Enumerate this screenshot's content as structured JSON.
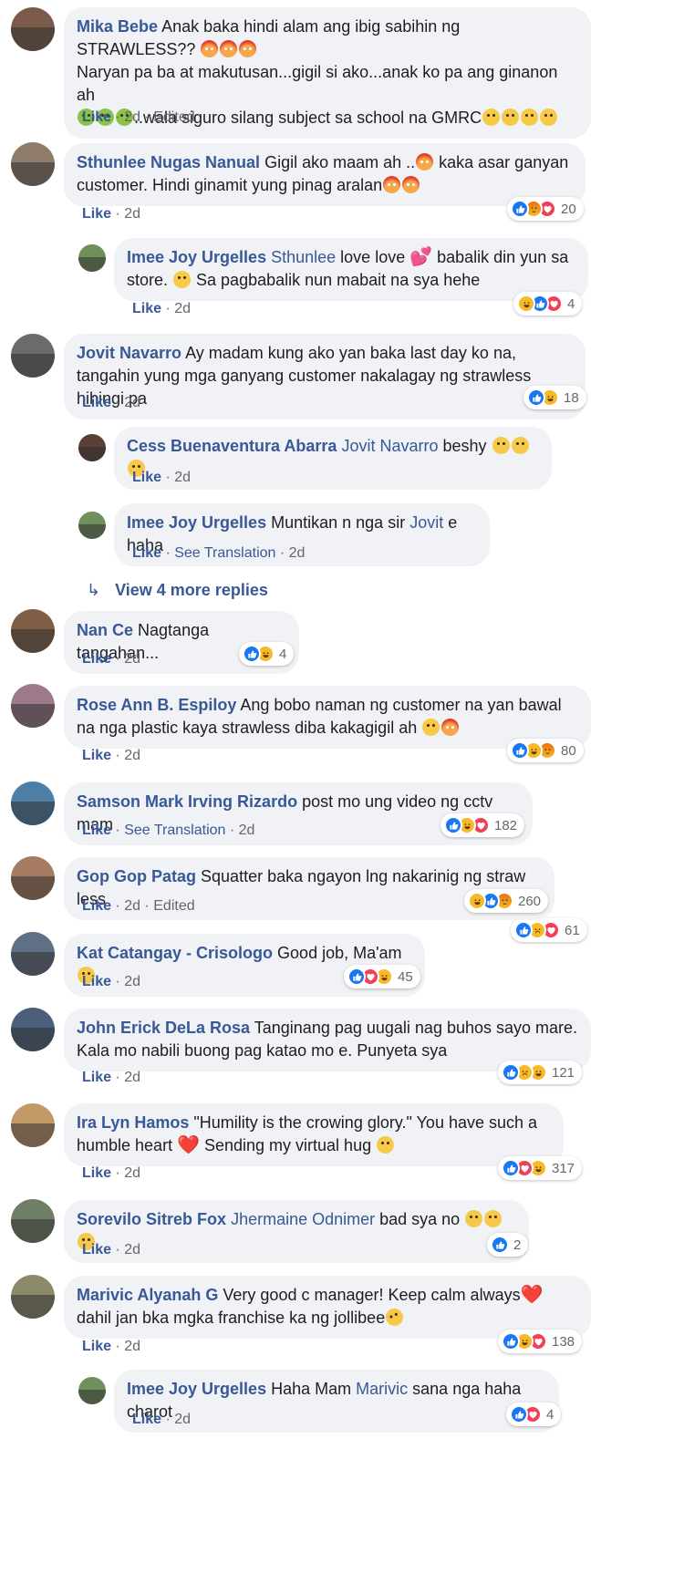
{
  "comments": [
    {
      "author": "Mika Bebe",
      "parts": [
        {
          "t": "Anak baka hindi alam ang ibig sabihin ng STRAWLESS?? "
        },
        {
          "e": "angry"
        },
        {
          "e": "angry"
        },
        {
          "e": "angry"
        },
        {
          "br": true
        },
        {
          "t": "Naryan pa ba at makutusan...gigil si ako...anak ko pa ang ginanon ah "
        },
        {
          "br": true
        },
        {
          "e": "sick"
        },
        {
          "e": "sick"
        },
        {
          "e": "sick"
        },
        {
          "t": "..wala siguro silang subject sa school na GMRC"
        },
        {
          "e": "neutral"
        },
        {
          "e": "neutral"
        },
        {
          "e": "neutral"
        },
        {
          "e": "neutral"
        }
      ],
      "like_label": "Like",
      "time": "2d",
      "edited": "Edited",
      "reactions": [
        "like",
        "sad",
        "love"
      ],
      "reaction_count": "61"
    },
    {
      "author": "Sthunlee Nugas Nanual",
      "parts": [
        {
          "t": "Gigil ako maam ah .."
        },
        {
          "e": "angry"
        },
        {
          "t": " kaka asar ganyan customer. Hindi ginamit yung pinag aralan"
        },
        {
          "e": "angry"
        },
        {
          "e": "angry"
        }
      ],
      "like_label": "Like",
      "time": "2d",
      "reactions": [
        "like",
        "angry",
        "love"
      ],
      "reaction_count": "20"
    },
    {
      "author": "Imee Joy Urgelles",
      "reply": true,
      "parts": [
        {
          "tag": "Sthunlee"
        },
        {
          "t": " love love "
        },
        {
          "heart": "💕"
        },
        {
          "t": " babalik din yun sa store. "
        },
        {
          "e": "smile"
        },
        {
          "t": " Sa pagbabalik nun mabait na sya hehe"
        }
      ],
      "like_label": "Like",
      "time": "2d",
      "reactions": [
        "haha",
        "like",
        "love"
      ],
      "reaction_count": "4"
    },
    {
      "author": "Jovit Navarro",
      "parts": [
        {
          "t": "Ay madam kung ako yan baka last day ko na, tangahin yung mga ganyang customer nakalagay ng strawless hihingi pa"
        }
      ],
      "like_label": "Like",
      "time": "2d",
      "reactions": [
        "like",
        "haha"
      ],
      "reaction_count": "18"
    },
    {
      "author": "Cess Buenaventura Abarra",
      "reply": true,
      "parts": [
        {
          "tag": "Jovit Navarro"
        },
        {
          "t": " beshy "
        },
        {
          "e": "laugh"
        },
        {
          "e": "laugh"
        },
        {
          "e": "laugh"
        }
      ],
      "like_label": "Like",
      "time": "2d"
    },
    {
      "author": "Imee Joy Urgelles",
      "reply": true,
      "parts": [
        {
          "t": "Muntikan n nga sir "
        },
        {
          "tag": "Jovit"
        },
        {
          "t": " e haha"
        }
      ],
      "like_label": "Like",
      "see_translation": "See Translation",
      "time": "2d"
    },
    {
      "author": "Nan Ce",
      "parts": [
        {
          "t": "Nagtanga tangahan..."
        }
      ],
      "like_label": "Like",
      "time": "2d",
      "reactions": [
        "like",
        "haha"
      ],
      "reaction_count": "4"
    },
    {
      "author": "Rose Ann B. Espiloy",
      "parts": [
        {
          "t": "Ang bobo naman ng customer na yan bawal na nga plastic kaya strawless diba kakagigil ah "
        },
        {
          "e": "frown"
        },
        {
          "e": "angry"
        }
      ],
      "like_label": "Like",
      "time": "2d",
      "reactions": [
        "like",
        "haha",
        "angry"
      ],
      "reaction_count": "80"
    },
    {
      "author": "Samson Mark Irving Rizardo",
      "parts": [
        {
          "t": "post mo ung video ng cctv mam"
        }
      ],
      "like_label": "Like",
      "see_translation": "See Translation",
      "time": "2d",
      "reactions": [
        "like",
        "haha",
        "love"
      ],
      "reaction_count": "182"
    },
    {
      "author": "Gop Gop Patag",
      "parts": [
        {
          "t": "Squatter baka ngayon lng nakarinig ng straw less"
        }
      ],
      "like_label": "Like",
      "time": "2d",
      "edited": "Edited",
      "reactions": [
        "haha",
        "like",
        "angry"
      ],
      "reaction_count": "260"
    },
    {
      "author": "Kat Catangay - Crisologo",
      "parts": [
        {
          "t": "Good job, Ma'am "
        },
        {
          "e": "kiss"
        }
      ],
      "like_label": "Like",
      "time": "2d",
      "reactions": [
        "like",
        "love",
        "haha"
      ],
      "reaction_count": "45"
    },
    {
      "author": "John Erick DeLa Rosa",
      "parts": [
        {
          "t": "Tanginang pag uugali nag buhos sayo mare. Kala mo nabili buong pag katao mo e. Punyeta sya"
        }
      ],
      "like_label": "Like",
      "time": "2d",
      "reactions": [
        "like",
        "sad",
        "haha"
      ],
      "reaction_count": "121"
    },
    {
      "author": "Ira Lyn Hamos",
      "parts": [
        {
          "t": "\"Humility is the crowing glory.\" You have such a humble heart "
        },
        {
          "heart": "❤️"
        },
        {
          "t": " Sending my virtual hug "
        },
        {
          "e": "mask"
        }
      ],
      "like_label": "Like",
      "time": "2d",
      "reactions": [
        "like",
        "love",
        "haha"
      ],
      "reaction_count": "317"
    },
    {
      "author": "Sorevilo Sitreb Fox",
      "parts": [
        {
          "tag": "Jhermaine Odnimer"
        },
        {
          "t": " bad sya no "
        },
        {
          "e": "frown"
        },
        {
          "e": "frown"
        },
        {
          "e": "frown"
        }
      ],
      "like_label": "Like",
      "time": "2d",
      "reactions": [
        "like"
      ],
      "reaction_count": "2"
    },
    {
      "author": "Marivic Alyanah G",
      "parts": [
        {
          "t": "Very good c manager! Keep calm always"
        },
        {
          "heart": "❤️"
        },
        {
          "t": " dahil jan bka mgka franchise ka ng jollibee"
        },
        {
          "e": "rofl"
        }
      ],
      "like_label": "Like",
      "time": "2d",
      "reactions": [
        "like",
        "haha",
        "love"
      ],
      "reaction_count": "138"
    },
    {
      "author": "Imee Joy Urgelles",
      "reply": true,
      "parts": [
        {
          "t": "Haha Mam "
        },
        {
          "tag": "Marivic"
        },
        {
          "t": " sana nga haha charot"
        }
      ],
      "like_label": "Like",
      "time": "2d",
      "reactions": [
        "like",
        "love"
      ],
      "reaction_count": "4"
    }
  ],
  "view_more": {
    "arrow": "↳",
    "label": "View 4 more replies"
  },
  "colors": {
    "link": "#385898",
    "bubble": "#f0f2f5",
    "meta": "#65676b",
    "like": "#1877f2",
    "love": "#f33e58",
    "haha": "#f7b928"
  }
}
